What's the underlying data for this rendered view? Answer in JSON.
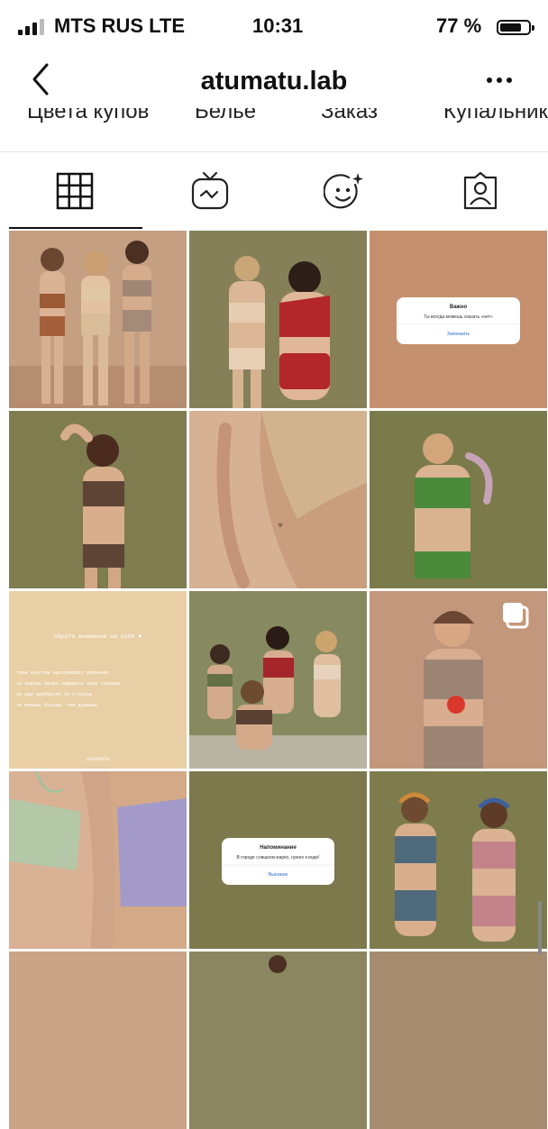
{
  "status_bar": {
    "carrier": "MTS RUS LTE",
    "time": "10:31",
    "battery_percent": "77 %",
    "battery_level": 0.77
  },
  "header": {
    "username": "atumatu.lab"
  },
  "highlights": [
    "Цвета купов",
    "Белье",
    "Заказ",
    "Купальник"
  ],
  "tabs": [
    {
      "icon": "grid-icon",
      "active": true
    },
    {
      "icon": "igtv-icon",
      "active": false
    },
    {
      "icon": "effects-icon",
      "active": false
    },
    {
      "icon": "tagged-icon",
      "active": false
    }
  ],
  "posts": {
    "dialog1": {
      "title": "Важно",
      "body": "Ты всегда можешь сказать «нет»",
      "action": "Запомнить"
    },
    "text_post": {
      "heading": "обрати внимание на себя ♥",
      "lines": [
        "твои чувства заслуживают уважения",
        "ты имеешь право защищать твои границы",
        "не жди одобрения со стороны",
        "ты можешь больше, чем думаешь"
      ],
      "signature": "atumatu"
    },
    "dialog2": {
      "title": "Напоминание",
      "body": "В городе слишком жарко, нужно к воде!",
      "action": "Выезжаю"
    }
  },
  "colors": {
    "olive": "#7c7a4e",
    "peach": "#c5906e",
    "cream": "#e8cfa5"
  }
}
